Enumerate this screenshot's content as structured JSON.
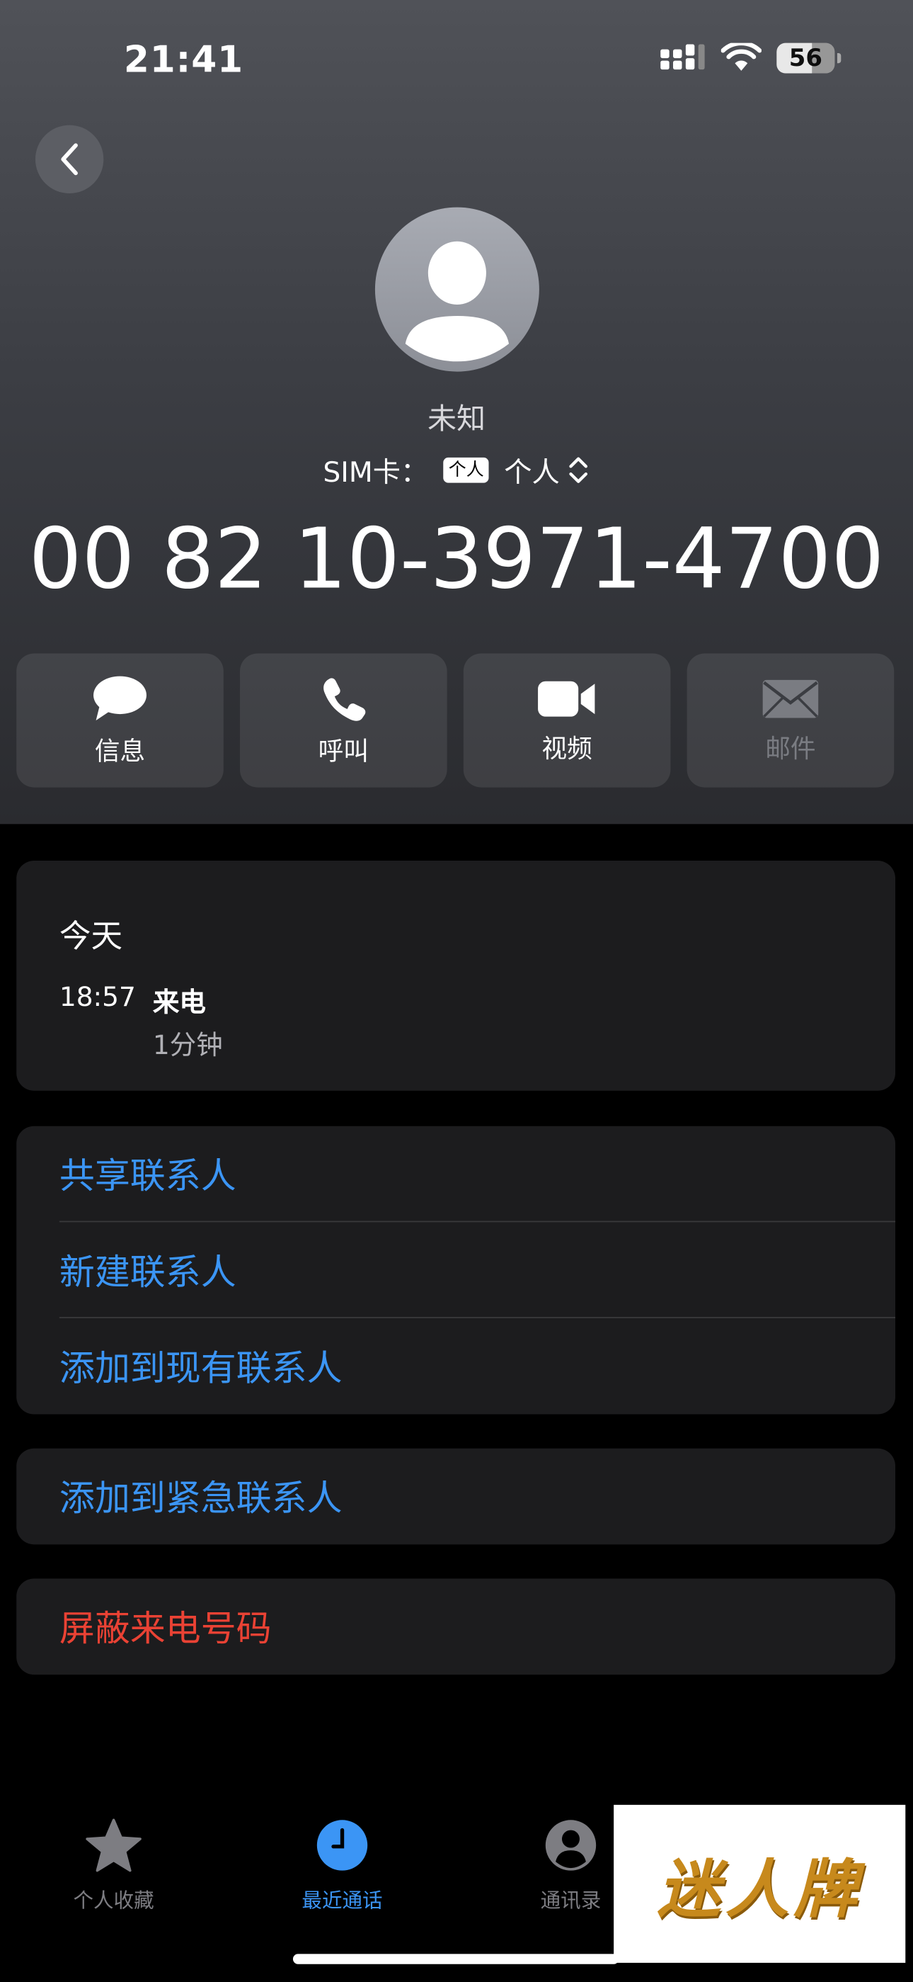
{
  "status_bar": {
    "time": "21:41",
    "battery": "56"
  },
  "contact": {
    "name": "未知",
    "sim_label": "SIM卡：",
    "sim_chip": "个人",
    "sim_value": "个人",
    "number": "00 82 10-3971-4700"
  },
  "actions": [
    {
      "label": "信息",
      "icon": "message-icon",
      "enabled": true
    },
    {
      "label": "呼叫",
      "icon": "phone-icon",
      "enabled": true
    },
    {
      "label": "视频",
      "icon": "video-icon",
      "enabled": true
    },
    {
      "label": "邮件",
      "icon": "mail-icon",
      "enabled": false
    }
  ],
  "history": {
    "day": "今天",
    "time": "18:57",
    "type": "来电",
    "duration": "1分钟"
  },
  "options": {
    "share": "共享联系人",
    "new_contact": "新建联系人",
    "add_existing": "添加到现有联系人",
    "add_emergency": "添加到紧急联系人",
    "block": "屏蔽来电号码"
  },
  "tabbar": [
    {
      "label": "个人收藏",
      "icon": "star-icon",
      "active": false
    },
    {
      "label": "最近通话",
      "icon": "clock-icon",
      "active": true
    },
    {
      "label": "通讯录",
      "icon": "contacts-icon",
      "active": false
    }
  ],
  "watermark": "迷人牌",
  "colors": {
    "accent": "#3b95f5",
    "destructive": "#ea4234",
    "card": "#1c1c1e"
  }
}
